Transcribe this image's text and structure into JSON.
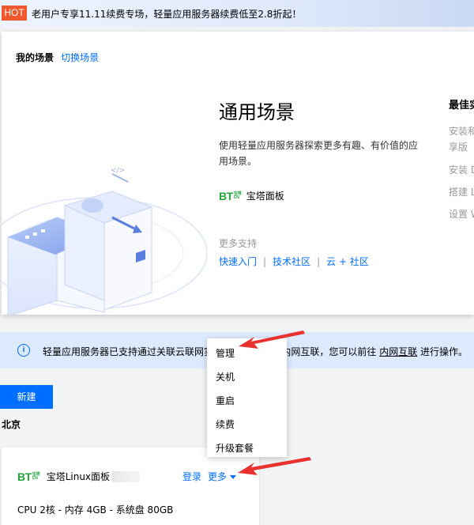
{
  "hot_banner": {
    "tag": "HOT",
    "text": "老用户专享11.11续费专场，轻量应用服务器续费低至2.8折起！"
  },
  "scene": {
    "title": "我的场景",
    "switch_label": "切换场景",
    "general_title": "通用场景",
    "general_desc": "使用轻量应用服务器探索更多有趣、有价值的应用场景。",
    "bt_logo_mark": "BT",
    "bt_logo_sub_top": "宝塔",
    "bt_logo_sub_bottom": "CN",
    "bt_name": "宝塔面板",
    "more_support": "更多支持",
    "support_links": [
      "快速入门",
      "技术社区",
      "云 + 社区"
    ],
    "best_title": "最佳实",
    "best_items": [
      "安装和",
      "享版",
      "安装 D",
      "搭建 L",
      "设置 W"
    ]
  },
  "info_banner": {
    "icon": "info-icon",
    "text_before": "轻量应用服务器已支持通过关联云联网实",
    "text_middle": "M内网互联，您可以前往",
    "link": "内网互联",
    "text_after": "进行操作。"
  },
  "new_button": "新建",
  "region": "北京",
  "instance": {
    "logo_mark": "BT",
    "logo_sub_top": "宝塔",
    "logo_sub_bottom": "CN",
    "name": "宝塔Linux面板",
    "login": "登录",
    "more": "更多",
    "spec": "CPU 2核 - 内存 4GB - 系统盘 80GB"
  },
  "dropdown": {
    "items": [
      "管理",
      "关机",
      "重启",
      "续费",
      "升级套餐"
    ]
  },
  "colors": {
    "accent": "#006eff",
    "hot": "#f0582d",
    "bt_green": "#20a53a",
    "annotation_red": "#e8322f"
  }
}
